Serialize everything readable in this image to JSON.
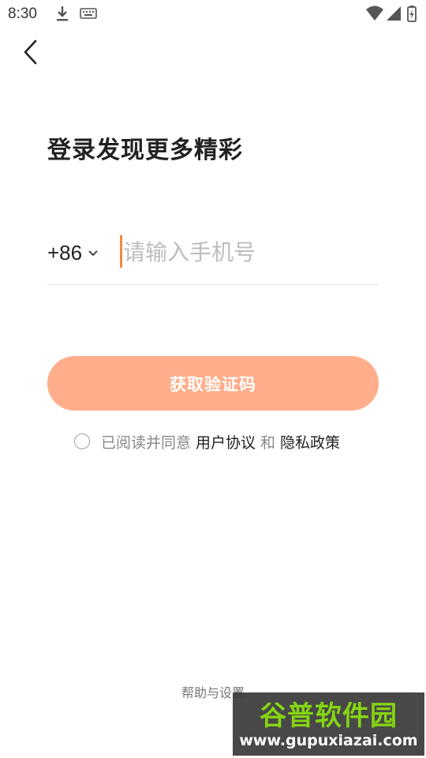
{
  "status_bar": {
    "time": "8:30",
    "icons": [
      "download-icon",
      "keyboard-icon",
      "wifi-icon",
      "cell-signal-icon",
      "battery-icon"
    ]
  },
  "header": {
    "back_icon": "chevron-left-icon",
    "title": "登录发现更多精彩"
  },
  "phone": {
    "country_code": "+86",
    "placeholder": "请输入手机号",
    "value": ""
  },
  "cta": {
    "label": "获取验证码",
    "color": "#ffad8a"
  },
  "agreement": {
    "prefix": "已阅读并同意",
    "user_agreement": "用户协议",
    "and": "和",
    "privacy_policy": "隐私政策",
    "checked": false
  },
  "footer": {
    "help_settings": "帮助与设置"
  },
  "watermark": {
    "brand": "谷普软件园",
    "url": "www.gupuxiazai.com"
  },
  "colors": {
    "accent": "#f08a3e",
    "button": "#ffad8a",
    "text": "#222222",
    "muted": "#888888"
  }
}
